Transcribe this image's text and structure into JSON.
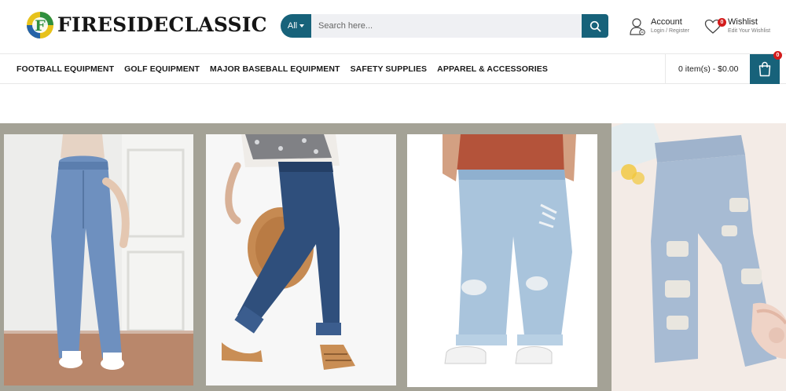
{
  "header": {
    "logo_letter": "F",
    "logo_text": "FIRESIDECLASSIC",
    "search": {
      "category": "All",
      "placeholder": "Search here..."
    },
    "account": {
      "title": "Account",
      "subtitle": "Login / Register"
    },
    "wishlist": {
      "title": "Wishlist",
      "subtitle": "Edit Your Wishlist",
      "count": "0"
    }
  },
  "nav": {
    "items": [
      {
        "label": "FOOTBALL EQUIPMENT"
      },
      {
        "label": "GOLF EQUIPMENT"
      },
      {
        "label": "MAJOR BASEBALL EQUIPMENT"
      },
      {
        "label": "SAFETY SUPPLIES"
      },
      {
        "label": "APPAREL & ACCESSORIES"
      }
    ],
    "cart": {
      "summary": "0 item(s) - $0.00",
      "count": "0"
    }
  },
  "hero": {
    "images": [
      {
        "icon": "jeans-photo-1"
      },
      {
        "icon": "jeans-photo-2"
      },
      {
        "icon": "jeans-photo-3"
      },
      {
        "icon": "jeans-photo-4"
      }
    ]
  },
  "colors": {
    "accent": "#17627a",
    "badge": "#d31c1c",
    "banner_bg": "#a4a296"
  }
}
